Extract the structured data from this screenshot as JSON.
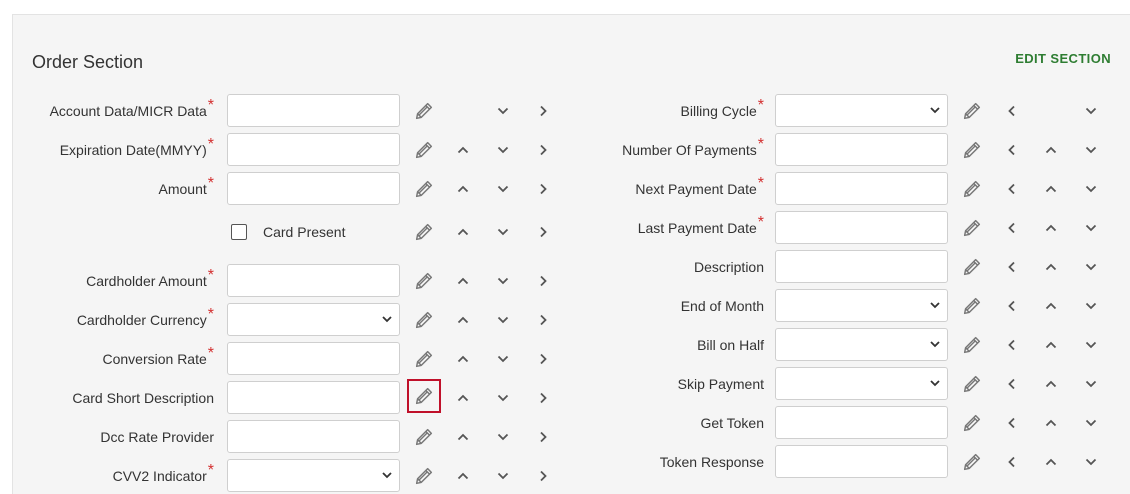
{
  "section": {
    "title": "Order Section",
    "edit_label": "EDIT SECTION"
  },
  "colors": {
    "required": "#d32f2f",
    "edit_link": "#2e7d32",
    "highlight": "#c0102a"
  },
  "left_fields": [
    {
      "label": "Account Data/MICR Data",
      "required": true,
      "type": "text",
      "value": "",
      "controls": [
        "edit",
        "down",
        "right"
      ]
    },
    {
      "label": "Expiration Date(MMYY)",
      "required": true,
      "type": "text",
      "value": "",
      "controls": [
        "edit",
        "up",
        "down",
        "right"
      ]
    },
    {
      "label": "Amount",
      "required": true,
      "type": "text",
      "value": "",
      "controls": [
        "edit",
        "up",
        "down",
        "right"
      ]
    },
    {
      "label": "Card Present",
      "required": false,
      "type": "checkbox",
      "checked": false,
      "controls": [
        "edit",
        "up",
        "down",
        "right"
      ]
    },
    {
      "label": "Cardholder Amount",
      "required": true,
      "type": "text",
      "value": "",
      "controls": [
        "edit",
        "up",
        "down",
        "right"
      ]
    },
    {
      "label": "Cardholder Currency",
      "required": true,
      "type": "select",
      "value": "",
      "controls": [
        "edit",
        "up",
        "down",
        "right"
      ]
    },
    {
      "label": "Conversion Rate",
      "required": true,
      "type": "text",
      "value": "",
      "controls": [
        "edit",
        "up",
        "down",
        "right"
      ]
    },
    {
      "label": "Card Short Description",
      "required": false,
      "type": "text",
      "value": "",
      "controls": [
        "edit",
        "up",
        "down",
        "right"
      ],
      "highlight_edit": true
    },
    {
      "label": "Dcc Rate Provider",
      "required": false,
      "type": "text",
      "value": "",
      "controls": [
        "edit",
        "up",
        "down",
        "right"
      ]
    },
    {
      "label": "CVV2 Indicator",
      "required": true,
      "type": "select",
      "value": "",
      "controls": [
        "edit",
        "up",
        "down",
        "right"
      ]
    }
  ],
  "right_fields": [
    {
      "label": "Billing Cycle",
      "required": true,
      "type": "select",
      "value": "",
      "controls": [
        "edit",
        "left",
        "down"
      ]
    },
    {
      "label": "Number Of Payments",
      "required": true,
      "type": "text",
      "value": "",
      "controls": [
        "edit",
        "left",
        "up",
        "down"
      ]
    },
    {
      "label": "Next Payment Date",
      "required": true,
      "type": "text",
      "value": "",
      "controls": [
        "edit",
        "left",
        "up",
        "down"
      ]
    },
    {
      "label": "Last Payment Date",
      "required": true,
      "type": "text",
      "value": "",
      "controls": [
        "edit",
        "left",
        "up",
        "down"
      ]
    },
    {
      "label": "Description",
      "required": false,
      "type": "text",
      "value": "",
      "controls": [
        "edit",
        "left",
        "up",
        "down"
      ]
    },
    {
      "label": "End of Month",
      "required": false,
      "type": "select",
      "value": "",
      "controls": [
        "edit",
        "left",
        "up",
        "down"
      ]
    },
    {
      "label": "Bill on Half",
      "required": false,
      "type": "select",
      "value": "",
      "controls": [
        "edit",
        "left",
        "up",
        "down"
      ]
    },
    {
      "label": "Skip Payment",
      "required": false,
      "type": "select",
      "value": "",
      "controls": [
        "edit",
        "left",
        "up",
        "down"
      ]
    },
    {
      "label": "Get Token",
      "required": false,
      "type": "text",
      "value": "",
      "controls": [
        "edit",
        "left",
        "up",
        "down"
      ]
    },
    {
      "label": "Token Response",
      "required": false,
      "type": "text",
      "value": "",
      "controls": [
        "edit",
        "left",
        "up",
        "down"
      ]
    }
  ]
}
